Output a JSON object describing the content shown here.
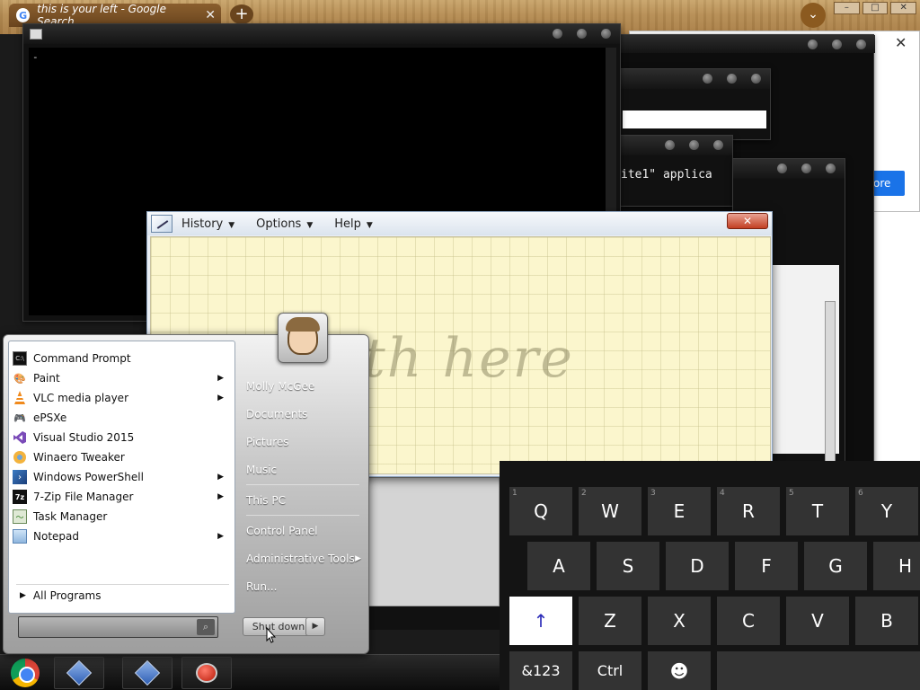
{
  "browser": {
    "tab_title": "this is your left - Google Search",
    "tab_close": "✕",
    "new_tab": "+",
    "chrome_menu": "⌄",
    "minimize": "–",
    "maximize": "□",
    "close": "✕",
    "popup_close": "✕",
    "more_button": "ore"
  },
  "cmd": {
    "cursor": "-"
  },
  "win_c": {
    "text": "ite1\" applica"
  },
  "math_input": {
    "menus": [
      "History",
      "Options",
      "Help"
    ],
    "close": "✕",
    "hint": "math here"
  },
  "start_menu": {
    "programs": [
      {
        "label": "Command Prompt",
        "icon": "cmd-icon",
        "submenu": false
      },
      {
        "label": "Paint",
        "icon": "paint-icon",
        "submenu": true
      },
      {
        "label": "VLC media player",
        "icon": "vlc-icon",
        "submenu": true
      },
      {
        "label": "ePSXe",
        "icon": "gamepad-icon",
        "submenu": false
      },
      {
        "label": "Visual Studio 2015",
        "icon": "visual-studio-icon",
        "submenu": false
      },
      {
        "label": "Winaero Tweaker",
        "icon": "winaero-icon",
        "submenu": false
      },
      {
        "label": "Windows PowerShell",
        "icon": "powershell-icon",
        "submenu": true
      },
      {
        "label": "7-Zip File Manager",
        "icon": "7zip-icon",
        "submenu": true
      },
      {
        "label": "Task Manager",
        "icon": "task-manager-icon",
        "submenu": false
      },
      {
        "label": "Notepad",
        "icon": "notepad-icon",
        "submenu": true
      }
    ],
    "all_programs": "All Programs",
    "search_placeholder": "",
    "right_items": [
      "Molly McGee",
      "Documents",
      "Pictures",
      "Music",
      "This PC",
      "Control Panel",
      "Administrative Tools",
      "Run..."
    ],
    "shutdown": "Shut down"
  },
  "keyboard": {
    "row1": [
      {
        "k": "Q",
        "n": "1"
      },
      {
        "k": "W",
        "n": "2"
      },
      {
        "k": "E",
        "n": "3"
      },
      {
        "k": "R",
        "n": "4"
      },
      {
        "k": "T",
        "n": "5"
      },
      {
        "k": "Y",
        "n": "6"
      }
    ],
    "row2": [
      "A",
      "S",
      "D",
      "F",
      "G",
      "H"
    ],
    "row3": [
      "↑",
      "Z",
      "X",
      "C",
      "V",
      "B"
    ],
    "row4": [
      "&123",
      "Ctrl",
      "☻"
    ]
  },
  "colors": {
    "keyboard_bg": "#141414",
    "key_bg": "#333333",
    "accent_blue": "#2b2bb8",
    "math_paper": "#fbf6cd"
  }
}
